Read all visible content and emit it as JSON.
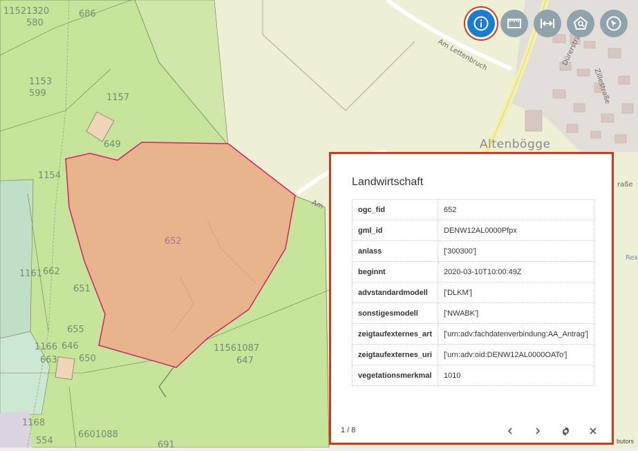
{
  "map": {
    "parcel_numbers": [
      {
        "text": "11521320",
        "name": "parcel-number-11521320"
      },
      {
        "text": "580",
        "name": "parcel-number-580"
      },
      {
        "text": "686",
        "name": "parcel-number-686"
      },
      {
        "text": "1153",
        "name": "parcel-number-1153"
      },
      {
        "text": "599",
        "name": "parcel-number-599"
      },
      {
        "text": "1157",
        "name": "parcel-number-1157"
      },
      {
        "text": "649",
        "name": "parcel-number-649"
      },
      {
        "text": "1154",
        "name": "parcel-number-1154"
      },
      {
        "text": "1161",
        "name": "parcel-number-1161"
      },
      {
        "text": "662",
        "name": "parcel-number-662"
      },
      {
        "text": "651",
        "name": "parcel-number-651"
      },
      {
        "text": "655",
        "name": "parcel-number-655"
      },
      {
        "text": "1166",
        "name": "parcel-number-1166"
      },
      {
        "text": "646",
        "name": "parcel-number-646"
      },
      {
        "text": "663",
        "name": "parcel-number-663"
      },
      {
        "text": "650",
        "name": "parcel-number-650"
      },
      {
        "text": "11561087",
        "name": "parcel-number-11561087"
      },
      {
        "text": "647",
        "name": "parcel-number-647"
      },
      {
        "text": "1168",
        "name": "parcel-number-1168"
      },
      {
        "text": "554",
        "name": "parcel-number-554"
      },
      {
        "text": "6601088",
        "name": "parcel-number-6601088"
      },
      {
        "text": "691",
        "name": "parcel-number-691"
      }
    ],
    "selected_parcel_label": "652",
    "place_name": "Altenbögge",
    "streets": {
      "am_lettenbruch": "Am Lettenbruch",
      "duerrstrasse": "Dürerstraße",
      "zillestrasse": "Zillestraße",
      "strasse_fragment": "raße",
      "rex_fragment": "Rex",
      "am_fragment": "Am"
    },
    "colors": {
      "selected_fill": "#e8b48c",
      "selected_stroke": "#d1206b",
      "field_green": "#c6e49a",
      "meadow_green": "#d3ecb0",
      "farmland": "#eef0d5"
    }
  },
  "toolbar": {
    "tools": [
      {
        "name": "info-tool-button",
        "icon": "info-icon",
        "active": true
      },
      {
        "name": "area-measure-tool-button",
        "icon": "ruler-icon",
        "active": false
      },
      {
        "name": "distance-measure-tool-button",
        "icon": "distance-icon",
        "active": false
      },
      {
        "name": "polygon-select-tool-button",
        "icon": "polygon-select-icon",
        "active": false
      },
      {
        "name": "pointer-tool-button",
        "icon": "pointer-icon",
        "active": false
      }
    ]
  },
  "attribution": "butors",
  "feature_info": {
    "title": "Landwirtschaft",
    "rows": [
      {
        "key": "ogc_fid",
        "value": "652"
      },
      {
        "key": "gml_id",
        "value": "DENW12AL0000Pfpx"
      },
      {
        "key": "anlass",
        "value": "['300300']"
      },
      {
        "key": "beginnt",
        "value": "2020-03-10T10:00:49Z"
      },
      {
        "key": "advstandardmodell",
        "value": "['DLKM']"
      },
      {
        "key": "sonstigesmodell",
        "value": "['NWABK']"
      },
      {
        "key": "zeigtaufexternes_art",
        "value": "['urn:adv:fachdatenverbindung:AA_Antrag']"
      },
      {
        "key": "zeigtaufexternes_uri",
        "value": "['urn:adv:oid:DENW12AL0000OATo']"
      },
      {
        "key": "vegetationsmerkmal",
        "value": "1010"
      }
    ],
    "pager": "1 / 8",
    "buttons": {
      "prev_icon": "chevron-left-icon",
      "next_icon": "chevron-right-icon",
      "settings_icon": "gear-icon",
      "close_icon": "close-icon"
    }
  }
}
